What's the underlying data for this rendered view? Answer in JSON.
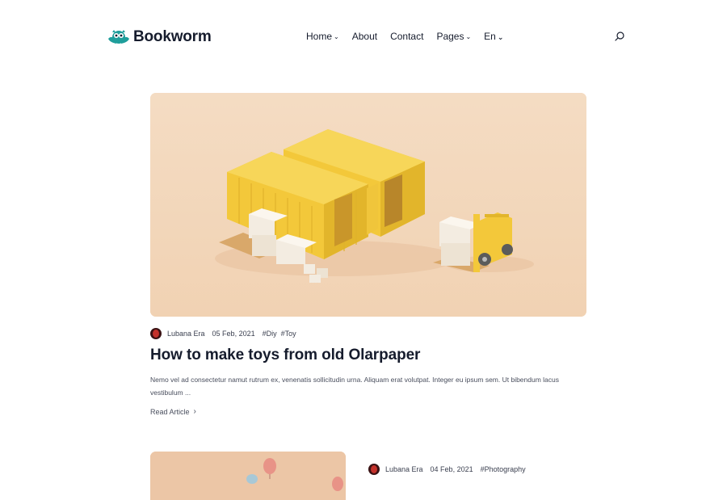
{
  "brand": {
    "name": "Bookworm",
    "accent": "#1f9e9b"
  },
  "nav": {
    "items": [
      {
        "label": "Home",
        "chevron": true
      },
      {
        "label": "About",
        "chevron": false
      },
      {
        "label": "Contact",
        "chevron": false
      },
      {
        "label": "Pages",
        "chevron": true
      }
    ],
    "language": "En",
    "search_icon": "search-icon"
  },
  "featured": {
    "image": "yellow shipping containers with forklift and boxes",
    "author": "Lubana Era",
    "date": "05 Feb, 2021",
    "tags": [
      "#Diy",
      "#Toy"
    ],
    "title": "How to make toys from old Olarpaper",
    "excerpt": "Nemo vel ad consectetur namut rutrum ex, venenatis sollicitudin urna. Aliquam erat volutpat. Integer eu ipsum sem. Ut bibendum lacus vestibulum ...",
    "read_more": "Read Article",
    "read_more_icon": "chevron-right-icon"
  },
  "second": {
    "image": "pink background with hot air balloons",
    "author": "Lubana Era",
    "date": "04 Feb, 2021",
    "tags": [
      "#Photography"
    ]
  }
}
